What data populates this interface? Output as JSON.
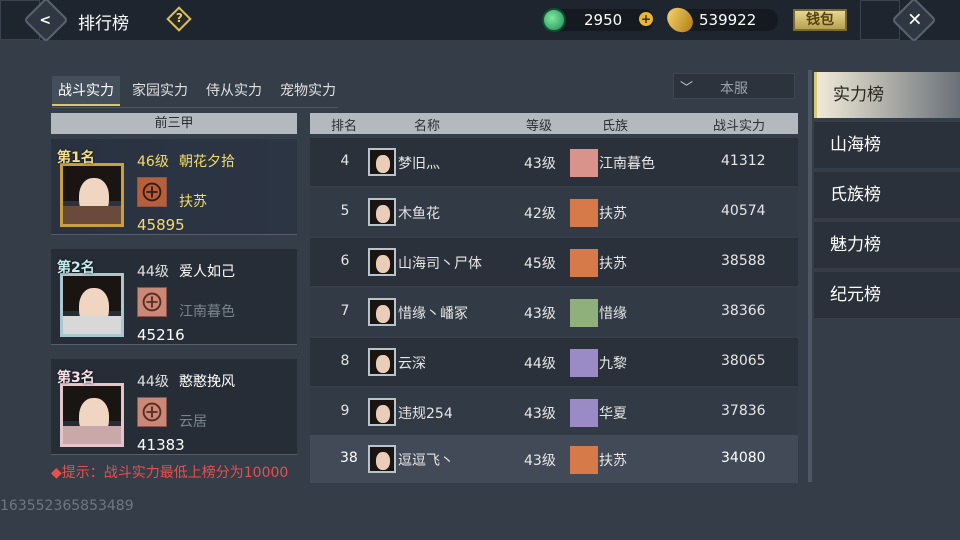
{
  "header": {
    "title": "排行榜",
    "help": "?",
    "jade": "2950",
    "coins": "539922",
    "wallet_label": "钱包"
  },
  "tabs": [
    "战斗实力",
    "家园实力",
    "侍从实力",
    "宠物实力"
  ],
  "server_select": "本服",
  "top3": {
    "header": "前三甲",
    "entries": [
      {
        "rank_label": "第1名",
        "level": "46级",
        "name": "朝花夕拾",
        "clan": "扶苏",
        "power": "45895"
      },
      {
        "rank_label": "第2名",
        "level": "44级",
        "name": "爱人如己",
        "clan": "江南暮色",
        "power": "45216"
      },
      {
        "rank_label": "第3名",
        "level": "44级",
        "name": "憨憨挽风",
        "clan": "云居",
        "power": "41383"
      }
    ]
  },
  "table": {
    "headers": {
      "rank": "排名",
      "name": "名称",
      "level": "等级",
      "clan": "氏族",
      "power": "战斗实力"
    },
    "rows": [
      {
        "rank": "4",
        "name": "梦旧灬",
        "level": "43级",
        "clan": "江南暮色",
        "power": "41312",
        "badge_color": "#d9938a"
      },
      {
        "rank": "5",
        "name": "木鱼花",
        "level": "42级",
        "clan": "扶苏",
        "power": "40574",
        "badge_color": "#d67a4a"
      },
      {
        "rank": "6",
        "name": "山海司丶尸体",
        "level": "45级",
        "clan": "扶苏",
        "power": "38588",
        "badge_color": "#d67a4a"
      },
      {
        "rank": "7",
        "name": "惜缘丶嶓冢",
        "level": "43级",
        "clan": "惜缘",
        "power": "38366",
        "badge_color": "#8fb07a"
      },
      {
        "rank": "8",
        "name": "云深",
        "level": "44级",
        "clan": "九黎",
        "power": "38065",
        "badge_color": "#9a8ac6"
      },
      {
        "rank": "9",
        "name": "违规254",
        "level": "43级",
        "clan": "华夏",
        "power": "37836",
        "badge_color": "#9a8ac6"
      },
      {
        "rank": "38",
        "name": "逗逗飞丶",
        "level": "43级",
        "clan": "扶苏",
        "power": "34080",
        "badge_color": "#d67a4a"
      }
    ]
  },
  "tip": "◆提示：战斗实力最低上榜分为10000",
  "uid": "163552365853489",
  "side_tabs": [
    "实力榜",
    "山海榜",
    "氏族榜",
    "魅力榜",
    "纪元榜"
  ]
}
